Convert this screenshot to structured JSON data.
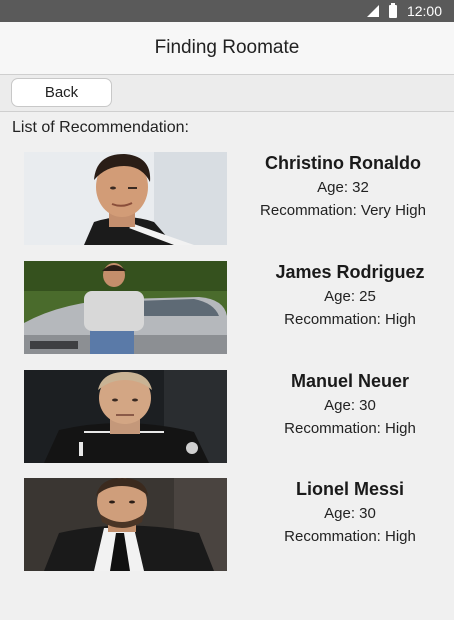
{
  "status_bar": {
    "time": "12:00",
    "signal_icon": "signal-icon",
    "battery_icon": "battery-icon"
  },
  "app": {
    "title": "Finding Roomate"
  },
  "toolbar": {
    "back_label": "Back"
  },
  "list": {
    "header": "List of Recommendation:",
    "items": [
      {
        "name": "Christino Ronaldo",
        "age": "Age: 32",
        "recommendation": "Recommation: Very High"
      },
      {
        "name": "James Rodriguez",
        "age": "Age: 25",
        "recommendation": "Recommation: High"
      },
      {
        "name": "Manuel Neuer",
        "age": "Age: 30",
        "recommendation": "Recommation: High"
      },
      {
        "name": "Lionel Messi",
        "age": "Age: 30",
        "recommendation": "Recommation: High"
      }
    ]
  }
}
